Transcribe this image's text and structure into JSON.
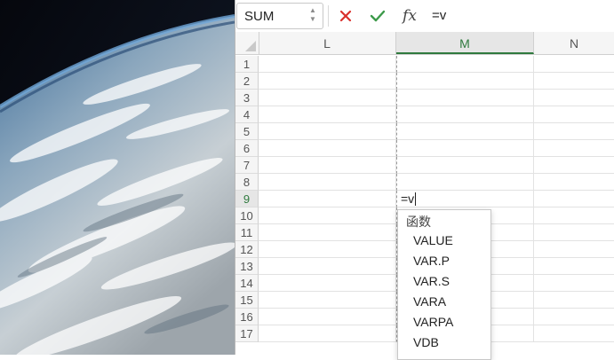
{
  "formula_bar": {
    "name_box_value": "SUM",
    "fx_label": "fx",
    "formula_text": "=v"
  },
  "columns": [
    "L",
    "M",
    "N"
  ],
  "rows": [
    "1",
    "2",
    "3",
    "4",
    "5",
    "6",
    "7",
    "8",
    "9",
    "10",
    "11",
    "12",
    "13",
    "14",
    "15",
    "16",
    "17"
  ],
  "active_cell": {
    "column": "M",
    "row": "9",
    "edit_text": "=v"
  },
  "autocomplete": {
    "header": "函数",
    "items": [
      "VALUE",
      "VAR.P",
      "VAR.S",
      "VARA",
      "VARPA",
      "VDB"
    ]
  },
  "icons": {
    "cancel": "x-icon",
    "enter": "check-icon",
    "function": "fx-icon",
    "name_box_stepper": "up-down-arrows-icon"
  },
  "colors": {
    "cancel": "#d9302c",
    "enter": "#3c9a4a",
    "active_header": "#2f7a3e"
  }
}
